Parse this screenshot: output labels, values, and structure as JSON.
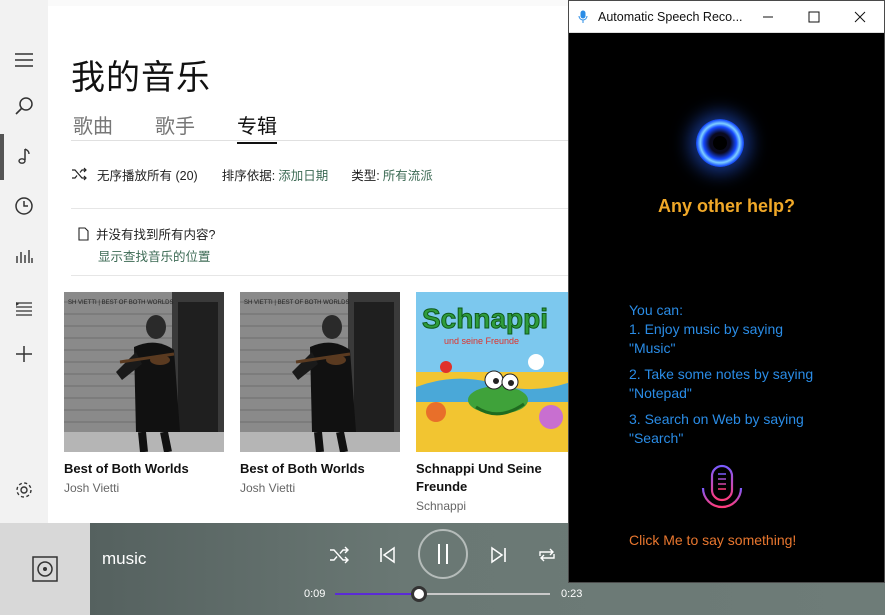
{
  "app": {
    "page_title": "我的音乐",
    "tabs": [
      {
        "label": "歌曲"
      },
      {
        "label": "歌手"
      },
      {
        "label": "专辑"
      }
    ],
    "toolbar": {
      "shuffle_label": "无序播放所有 (20)",
      "sort_label": "排序依据:",
      "sort_value": "添加日期",
      "type_label": "类型:",
      "type_value": "所有流派"
    },
    "notice": {
      "title": "并没有找到所有内容?",
      "link": "显示查找音乐的位置"
    },
    "albums": [
      {
        "title": "Best of Both Worlds",
        "artist": "Josh Vietti"
      },
      {
        "title": "Best of Both Worlds",
        "artist": "Josh Vietti"
      },
      {
        "title": "Schnappi Und Seine Freunde",
        "artist": "Schnappi",
        "cover_text": "Schnappi"
      }
    ]
  },
  "player": {
    "now_playing": "music",
    "elapsed": "0:09",
    "total": "0:23",
    "progress": 0.39
  },
  "speech_window": {
    "title": "Automatic Speech Reco...",
    "help_heading": "Any other help?",
    "tips_intro": "You can:",
    "tips": [
      {
        "line1": "1. Enjoy music by saying",
        "line2": "\"Music\""
      },
      {
        "line1": "2. Take some notes by saying",
        "line2": "\"Notepad\""
      },
      {
        "line1": "3. Search on Web by saying",
        "line2": "\"Search\""
      }
    ],
    "mic_prompt": "Click Me to say something!"
  },
  "colors": {
    "accent_green": "#3d6b55",
    "speech_heading": "#f0a828",
    "speech_tips": "#2a8ce6",
    "speech_prompt": "#e9772f",
    "progress_fill": "#5b2bd6"
  },
  "icons": [
    "hamburger-icon",
    "search-icon",
    "music-note-icon",
    "history-icon",
    "chart-icon",
    "playlist-icon",
    "add-icon",
    "gear-icon",
    "shuffle-icon",
    "previous-icon",
    "pause-icon",
    "next-icon",
    "repeat-icon",
    "microphone-icon",
    "orb-icon"
  ]
}
